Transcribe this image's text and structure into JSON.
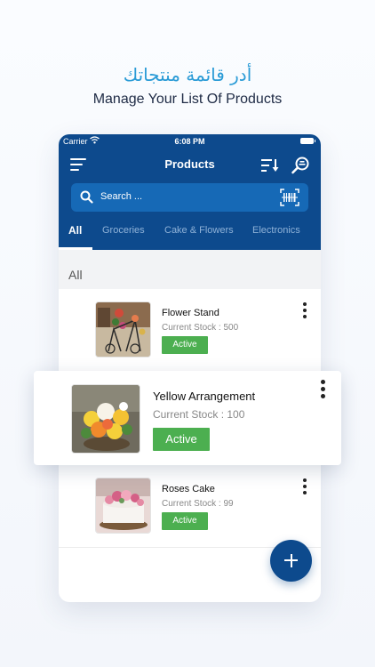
{
  "hero": {
    "arabic_title": "أدر قائمة منتجاتك",
    "english_title": "Manage Your List Of Products"
  },
  "status_bar": {
    "carrier": "Carrier",
    "time": "6:08 PM"
  },
  "header": {
    "title": "Products"
  },
  "search": {
    "placeholder": "Search ..."
  },
  "tabs": [
    {
      "label": "All",
      "active": true
    },
    {
      "label": "Groceries",
      "active": false
    },
    {
      "label": "Cake & Flowers",
      "active": false
    },
    {
      "label": "Electronics",
      "active": false
    }
  ],
  "section": {
    "label": "All"
  },
  "products": [
    {
      "name": "Flower Stand",
      "stock": "Current Stock : 500",
      "status": "Active"
    },
    {
      "name": "Yellow Arrangement",
      "stock": "Current Stock : 100",
      "status": "Active"
    },
    {
      "name": "Roses Cake",
      "stock": "Current Stock : 99",
      "status": "Active"
    }
  ],
  "colors": {
    "primary": "#0d4a8d",
    "search_bg": "#1669b6",
    "accent_arabic": "#2a9bd6",
    "active_badge": "#4caf50"
  },
  "icons": [
    "menu-icon",
    "sort-icon",
    "search-users-icon",
    "search-icon",
    "barcode-scan-icon",
    "more-vert-icon",
    "add-icon",
    "wifi-icon",
    "battery-icon"
  ]
}
